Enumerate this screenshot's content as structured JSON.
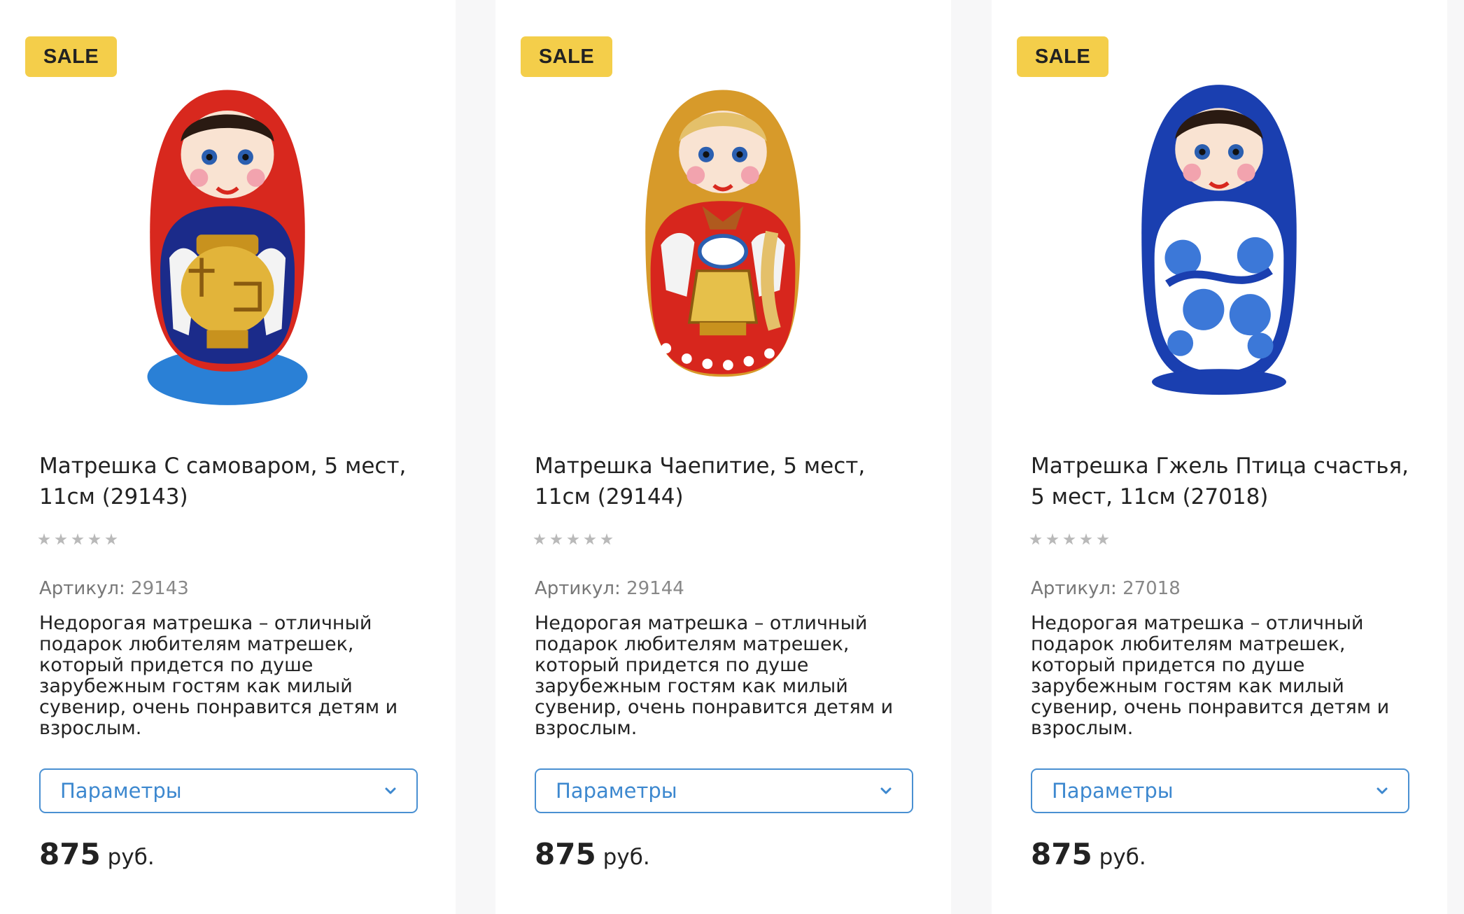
{
  "products": [
    {
      "badge": "SALE",
      "title": "Матрешка С самоваром, 5 мест, 11см (29143)",
      "rating_stars": 0,
      "sku_label": "Артикул:",
      "sku": "29143",
      "description": "Недорогая матрешка – отличный подарок любителям матрешек, который придется по душе зарубежным гостям как милый сувенир, очень понравится детям и взрослым.",
      "params_label": "Параметры",
      "price": "875",
      "currency": "руб.",
      "image_icon": "matryoshka-samovar-image",
      "colors": {
        "scarf": "#d8281e",
        "body": "#1b2b8a",
        "base": "#2a80d6",
        "accent": "#e2b43a"
      }
    },
    {
      "badge": "SALE",
      "title": "Матрешка Чаепитие, 5 мест, 11см (29144)",
      "rating_stars": 0,
      "sku_label": "Артикул:",
      "sku": "29144",
      "description": "Недорогая матрешка – отличный подарок любителям матрешек, который придется по душе зарубежным гостям как милый сувенир, очень понравится детям и взрослым.",
      "params_label": "Параметры",
      "price": "875",
      "currency": "руб.",
      "image_icon": "matryoshka-tea-party-image",
      "colors": {
        "scarf": "#d79a2a",
        "body": "#d7261d",
        "base": "#d7261d",
        "accent": "#e6c04a"
      }
    },
    {
      "badge": "SALE",
      "title": "Матрешка Гжель Птица счастья, 5 мест, 11см (27018)",
      "rating_stars": 0,
      "sku_label": "Артикул:",
      "sku": "27018",
      "description": "Недорогая матрешка – отличный подарок любителям матрешек, который придется по душе зарубежным гостям как милый сувенир, очень понравится детям и взрослым.",
      "params_label": "Параметры",
      "price": "875",
      "currency": "руб.",
      "image_icon": "matryoshka-gzhel-image",
      "colors": {
        "scarf": "#1a3fb0",
        "body": "#ffffff",
        "base": "#1a3fb0",
        "accent": "#3c78d8"
      }
    }
  ],
  "theme": {
    "badge_bg": "#f4ce4a",
    "link_blue": "#3d88cf",
    "star_grey": "#b9b9b9"
  }
}
